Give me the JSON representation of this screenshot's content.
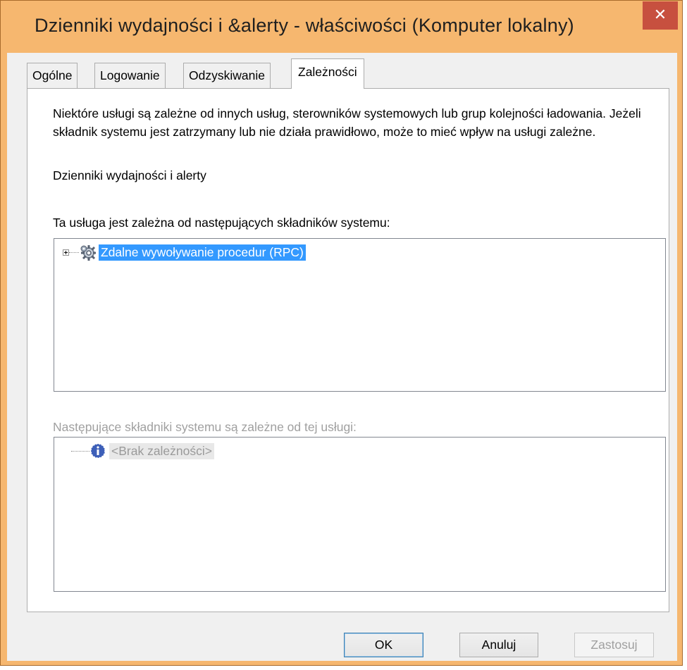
{
  "window": {
    "title": "Dzienniki wydajności i &alerty - właściwości (Komputer lokalny)",
    "close_label": "✕"
  },
  "tabs": [
    {
      "label": "Ogólne",
      "active": false
    },
    {
      "label": "Logowanie",
      "active": false
    },
    {
      "label": "Odzyskiwanie",
      "active": false
    },
    {
      "label": "Zależności",
      "active": true
    }
  ],
  "panel": {
    "description": "Niektóre usługi są zależne od innych usług, sterowników systemowych lub grup kolejności ładowania. Jeżeli składnik systemu jest zatrzymany lub nie działa prawidłowo, może to mieć wpływ na usługi zależne.",
    "service_name": "Dzienniki wydajności i alerty",
    "depends_on_label": "Ta usługa jest zależna od następujących składników systemu:",
    "depends_on_items": [
      {
        "label": "Zdalne wywoływanie procedur (RPC)",
        "icon": "service-gear-icon",
        "expandable": true,
        "selected": true
      }
    ],
    "dependents_label": "Następujące składniki systemu są zależne od tej usługi:",
    "dependents_items": [
      {
        "label": "<Brak zależności>",
        "icon": "info-icon",
        "expandable": false,
        "disabled": true
      }
    ]
  },
  "buttons": {
    "ok": "OK",
    "cancel": "Anuluj",
    "apply": "Zastosuj"
  },
  "colors": {
    "title_bar": "#F6B76F",
    "close_button": "#C7503F",
    "selection": "#3399FF"
  }
}
